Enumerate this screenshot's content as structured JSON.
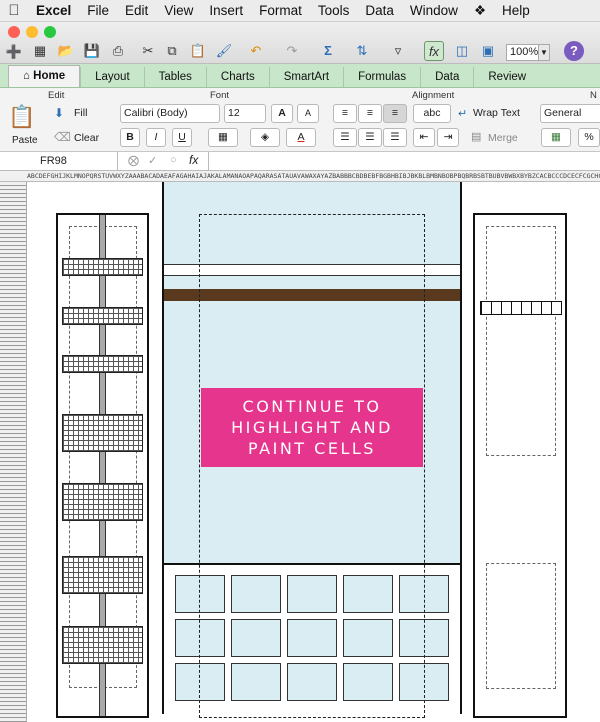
{
  "menubar": {
    "app_name": "Excel",
    "items": [
      "File",
      "Edit",
      "View",
      "Insert",
      "Format",
      "Tools",
      "Data",
      "Window",
      "Help"
    ]
  },
  "toolbar": {
    "zoom": "100%"
  },
  "tabs": [
    "Home",
    "Layout",
    "Tables",
    "Charts",
    "SmartArt",
    "Formulas",
    "Data",
    "Review"
  ],
  "ribbon": {
    "edit": {
      "label": "Edit",
      "paste": "Paste",
      "fill": "Fill",
      "clear": "Clear"
    },
    "font": {
      "label": "Font",
      "name": "Calibri (Body)",
      "size": "12",
      "bold": "B",
      "italic": "I",
      "underline": "U",
      "grow": "A",
      "shrink": "A",
      "color_letter": "A"
    },
    "alignment": {
      "label": "Alignment",
      "wrap": "Wrap Text",
      "abc": "abc",
      "merge": "Merge"
    },
    "number": {
      "label": "N",
      "format": "General",
      "percent": "%"
    }
  },
  "formula_bar": {
    "cell_ref": "FR98",
    "fx": "fx",
    "value": ""
  },
  "column_header_text": "ABCDEFGHIJKLMNOPQRSTUVWXYZAAABACADAEAFAGAHAIAJAKALAMANAOAPAQARASATAUAVAWAXAYAZBABBBCBDBEBFBGBHBIBJBKBLBMBNBOBPBQBRBSBTBUBVBWBXBYBZCACBCCCDCECFCGCHCICJCKCLCMCNCOCPCQCRCSCTCUCVCWCXCYCZDADBDCDDDEDFDGDHDIDJ",
  "banner": {
    "text": "CONTINUE TO\nHIGHLIGHT AND\nPAINT CELLS"
  },
  "colors": {
    "banner": "#e5358c",
    "sky": "#d9edf3",
    "shelf": "#5a3a1e",
    "ribbon_tabs": "#c8e6c9"
  }
}
